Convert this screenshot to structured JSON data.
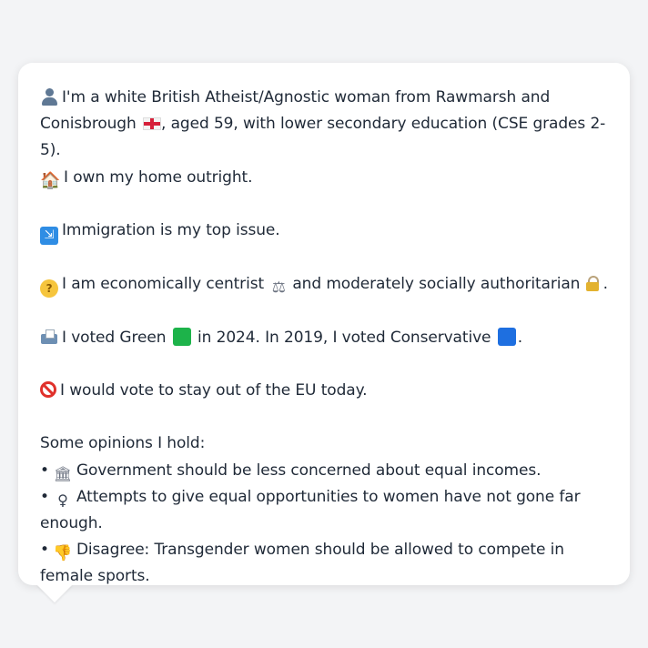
{
  "profile": {
    "line1_a": "I'm a white British Atheist/Agnostic woman from Rawmarsh and",
    "line1_b": "Conisbrough",
    "line1_c": ", aged 59, with lower secondary education (CSE grades 2-5).",
    "line1_d": "I own my home outright.",
    "top_issue": "Immigration is my top issue.",
    "econ_a": "I am economically centrist",
    "econ_b": "and moderately socially authoritarian",
    "econ_c": ".",
    "vote_a": "I voted Green",
    "vote_b": "in 2024. In 2019, I voted Conservative",
    "vote_c": ".",
    "eu": "I would vote to stay out of the EU today."
  },
  "opinions": {
    "heading": "Some opinions I hold:",
    "items": [
      "Government should be less concerned about equal incomes.",
      "Attempts to give equal opportunities to women have not gone far enough.",
      "Disagree: Transgender women should be allowed to compete in female sports."
    ],
    "bullet": "•"
  },
  "colors": {
    "green_party": "#1db34a",
    "conservative": "#1e6fe0",
    "text": "#1f2937",
    "background": "#f3f4f6",
    "bubble": "#ffffff"
  },
  "icons": {
    "person": "person-icon",
    "flag": "england-flag-icon",
    "house": "house-icon",
    "immigration": "immigration-icon",
    "thinking": "thinking-face-icon",
    "scale": "balance-scale-icon",
    "lock": "lock-icon",
    "ballot": "ballot-box-icon",
    "prohibit": "prohibited-icon",
    "government": "government-icon",
    "female": "female-sign-icon",
    "thumbs_down": "thumbs-down-icon"
  }
}
